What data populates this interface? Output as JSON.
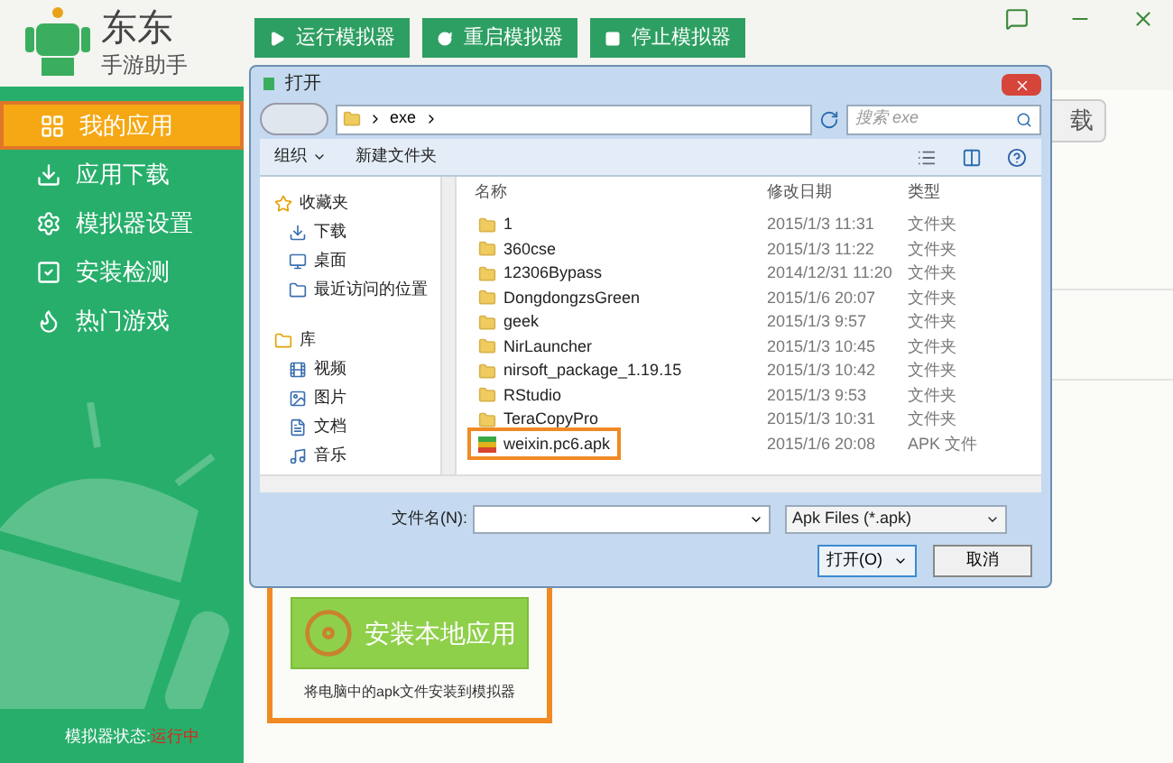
{
  "app": {
    "logo_title": "东东",
    "logo_subtitle": "手游助手"
  },
  "toolbar": [
    {
      "label": "运行模拟器"
    },
    {
      "label": "重启模拟器"
    },
    {
      "label": "停止模拟器"
    }
  ],
  "sidebar": {
    "items": [
      {
        "label": "我的应用",
        "selected": true
      },
      {
        "label": "应用下载",
        "selected": false
      },
      {
        "label": "模拟器设置",
        "selected": false
      },
      {
        "label": "安装检测",
        "selected": false
      },
      {
        "label": "热门游戏",
        "selected": false
      }
    ],
    "status_label": "模拟器状态:",
    "status_value": "运行中"
  },
  "main": {
    "uninstall_button": "载",
    "install_button": "安装本地应用",
    "install_hint": "将电脑中的apk文件安装到模拟器"
  },
  "dialog": {
    "title": "打开",
    "path": "exe",
    "search_placeholder": "搜索 exe",
    "organize": "组织",
    "new_folder": "新建文件夹",
    "nav": [
      {
        "kind": "group",
        "label": "收藏夹"
      },
      {
        "kind": "item",
        "label": "下载"
      },
      {
        "kind": "item",
        "label": "桌面"
      },
      {
        "kind": "item",
        "label": "最近访问的位置"
      },
      {
        "kind": "group",
        "label": "库"
      },
      {
        "kind": "item",
        "label": "视频"
      },
      {
        "kind": "item",
        "label": "图片"
      },
      {
        "kind": "item",
        "label": "文档"
      },
      {
        "kind": "item",
        "label": "音乐"
      }
    ],
    "columns": [
      "名称",
      "修改日期",
      "类型"
    ],
    "files": [
      {
        "kind": "folder",
        "name": "1",
        "date": "2015/1/3 11:31",
        "type": "文件夹",
        "highlighted": false
      },
      {
        "kind": "folder",
        "name": "360cse",
        "date": "2015/1/3 11:22",
        "type": "文件夹",
        "highlighted": false
      },
      {
        "kind": "folder",
        "name": "12306Bypass",
        "date": "2014/12/31 11:20",
        "type": "文件夹",
        "highlighted": false
      },
      {
        "kind": "folder",
        "name": "DongdongzsGreen",
        "date": "2015/1/6 20:07",
        "type": "文件夹",
        "highlighted": false
      },
      {
        "kind": "folder",
        "name": "geek",
        "date": "2015/1/3 9:57",
        "type": "文件夹",
        "highlighted": false
      },
      {
        "kind": "folder",
        "name": "NirLauncher",
        "date": "2015/1/3 10:45",
        "type": "文件夹",
        "highlighted": false
      },
      {
        "kind": "folder",
        "name": "nirsoft_package_1.19.15",
        "date": "2015/1/3 10:42",
        "type": "文件夹",
        "highlighted": false
      },
      {
        "kind": "folder",
        "name": "RStudio",
        "date": "2015/1/3 9:53",
        "type": "文件夹",
        "highlighted": false
      },
      {
        "kind": "folder",
        "name": "TeraCopyPro",
        "date": "2015/1/3 10:31",
        "type": "文件夹",
        "highlighted": false
      },
      {
        "kind": "apk",
        "name": "weixin.pc6.apk",
        "date": "2015/1/6 20:08",
        "type": "APK 文件",
        "highlighted": true
      }
    ],
    "filename_label": "文件名(N):",
    "filetype": "Apk Files (*.apk)",
    "open_button": "打开(O)",
    "cancel_button": "取消"
  }
}
